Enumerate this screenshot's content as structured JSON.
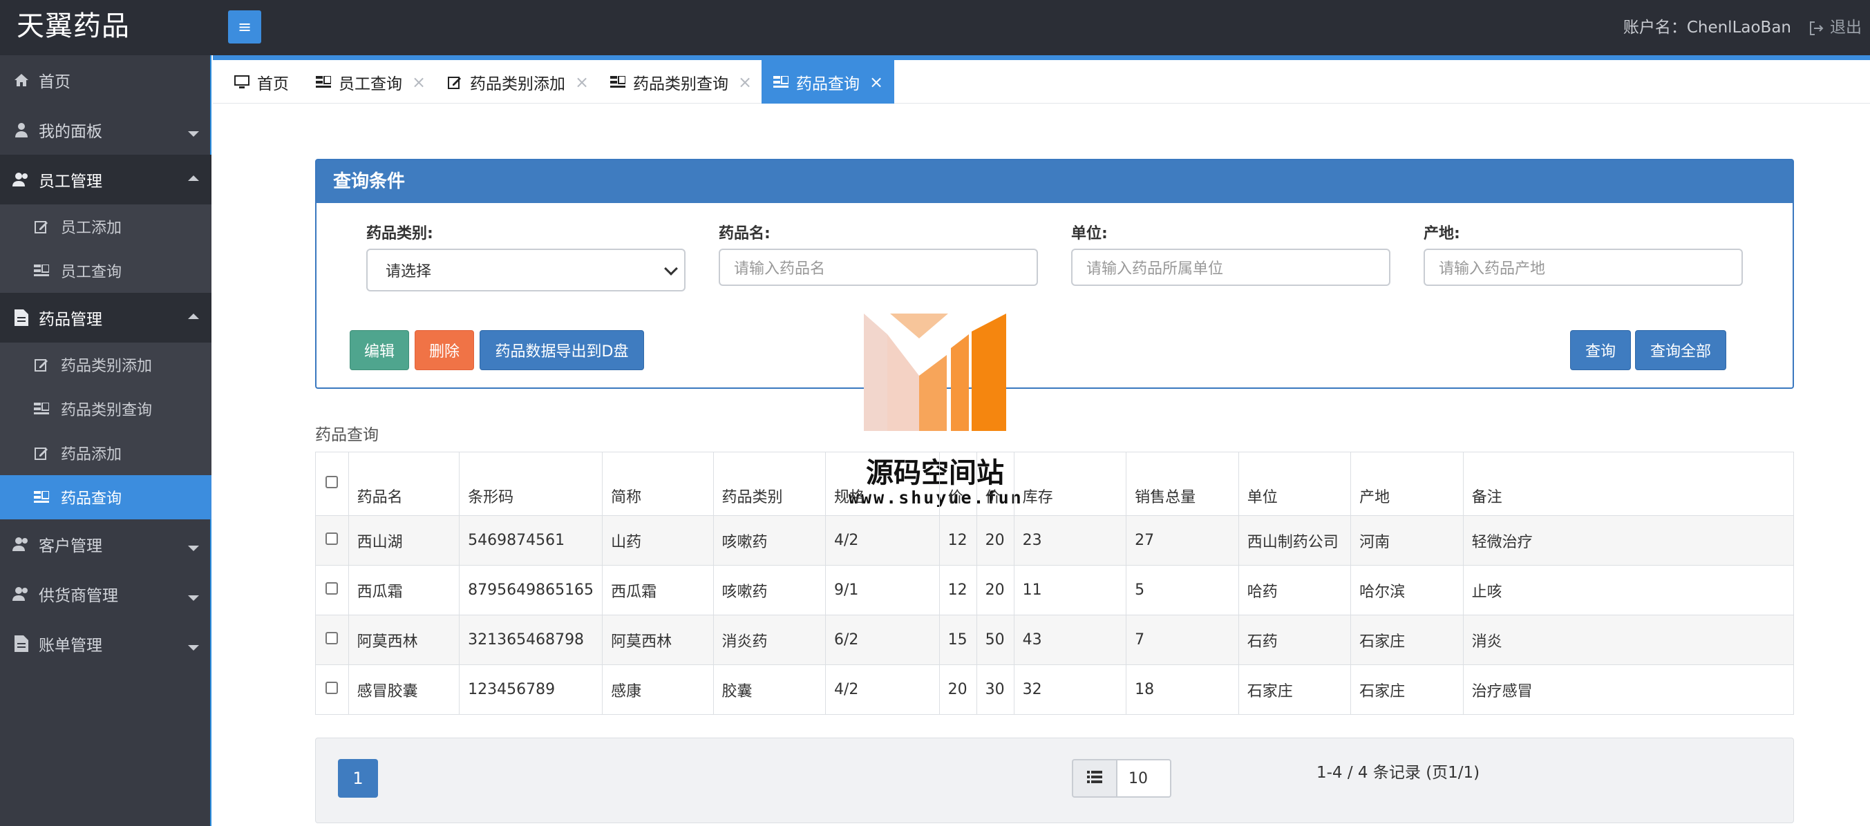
{
  "app": {
    "brand": "天翼药品",
    "account_label": "账户名：ChenlLaoBan",
    "logout_label": "退出",
    "menu_toggle_glyph": "≡"
  },
  "sidebar": {
    "items": [
      {
        "label": "首页",
        "icon": "home-icon"
      },
      {
        "label": "我的面板",
        "icon": "user-icon"
      },
      {
        "label": "员工管理",
        "icon": "users-icon"
      },
      {
        "label": "员工添加",
        "icon": "edit-icon"
      },
      {
        "label": "员工查询",
        "icon": "list-icon"
      },
      {
        "label": "药品管理",
        "icon": "document-icon"
      },
      {
        "label": "药品类别添加",
        "icon": "edit-icon"
      },
      {
        "label": "药品类别查询",
        "icon": "list-icon"
      },
      {
        "label": "药品添加",
        "icon": "edit-icon"
      },
      {
        "label": "药品查询",
        "icon": "list-icon"
      },
      {
        "label": "客户管理",
        "icon": "users-icon"
      },
      {
        "label": "供货商管理",
        "icon": "users-icon"
      },
      {
        "label": "账单管理",
        "icon": "document-icon"
      }
    ]
  },
  "tabs": [
    {
      "label": "首页",
      "icon": "monitor-icon",
      "closable": false
    },
    {
      "label": "员工查询",
      "icon": "list-icon",
      "closable": true
    },
    {
      "label": "药品类别添加",
      "icon": "edit-icon",
      "closable": true
    },
    {
      "label": "药品类别查询",
      "icon": "list-icon",
      "closable": true
    },
    {
      "label": "药品查询",
      "icon": "list-icon",
      "closable": true,
      "active": true
    }
  ],
  "tab_close_glyph": "×",
  "query_panel": {
    "title": "查询条件",
    "fields": [
      {
        "label": "药品类别:",
        "type": "select",
        "value": "请选择"
      },
      {
        "label": "药品名:",
        "type": "input",
        "placeholder": "请输入药品名"
      },
      {
        "label": "单位:",
        "type": "input",
        "placeholder": "请输入药品所属单位"
      },
      {
        "label": "产地:",
        "type": "input",
        "placeholder": "请输入药品产地"
      }
    ],
    "buttons": {
      "edit": "编辑",
      "delete": "删除",
      "export": "药品数据导出到D盘",
      "query": "查询",
      "query_all": "查询全部"
    }
  },
  "watermark": {
    "title": "源码空间站",
    "url": "www.shuyue.fun"
  },
  "table": {
    "title": "药品查询",
    "columns": [
      "药品名",
      "条形码",
      "简称",
      "药品类别",
      "规格",
      "价",
      "价",
      "库存",
      "销售总量",
      "单位",
      "产地",
      "备注"
    ],
    "rows": [
      [
        "西山湖",
        "5469874561",
        "山药",
        "咳嗽药",
        "4/2",
        "12",
        "20",
        "23",
        "27",
        "西山制药公司",
        "河南",
        "轻微治疗"
      ],
      [
        "西瓜霜",
        "8795649865165",
        "西瓜霜",
        "咳嗽药",
        "9/1",
        "12",
        "20",
        "11",
        "5",
        "哈药",
        "哈尔滨",
        "止咳"
      ],
      [
        "阿莫西林",
        "321365468798",
        "阿莫西林",
        "消炎药",
        "6/2",
        "15",
        "50",
        "43",
        "7",
        "石药",
        "石家庄",
        "消炎"
      ],
      [
        "感冒胶囊",
        "123456789",
        "感康",
        "胶囊",
        "4/2",
        "20",
        "30",
        "32",
        "18",
        "石家庄",
        "石家庄",
        "治疗感冒"
      ]
    ]
  },
  "pagination": {
    "current_page": "1",
    "page_size": "10",
    "records": "1-4 / 4 条记录 (页1/1)"
  },
  "colors": {
    "primary": "#3c8dde",
    "header_bg": "#2b2e36",
    "sidebar_bg": "#383b44",
    "panel_header": "#3f7cc0",
    "edit": "#4fa58e",
    "delete": "#f07346"
  }
}
